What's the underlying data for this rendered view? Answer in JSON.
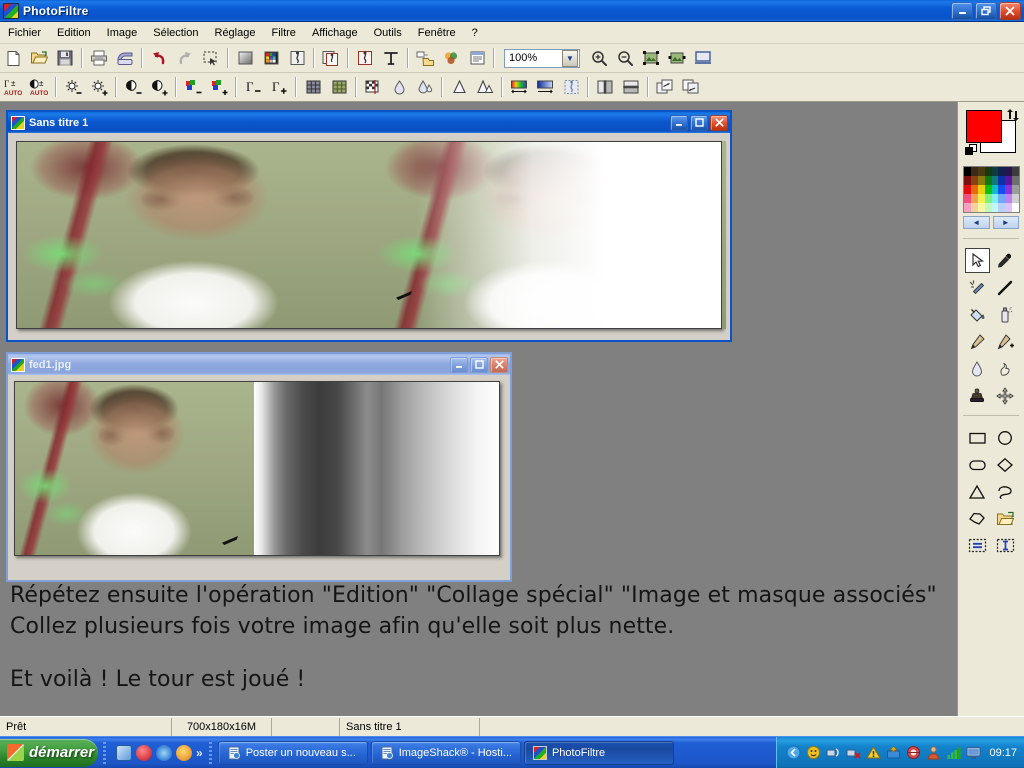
{
  "app": {
    "title": "PhotoFiltre",
    "icon": "photofiltre-icon"
  },
  "window_controls": {
    "minimize": "_",
    "restore": "❐",
    "close": "✕"
  },
  "menu": {
    "items": [
      {
        "label": "Fichier"
      },
      {
        "label": "Edition"
      },
      {
        "label": "Image"
      },
      {
        "label": "Sélection"
      },
      {
        "label": "Réglage"
      },
      {
        "label": "Filtre"
      },
      {
        "label": "Affichage"
      },
      {
        "label": "Outils"
      },
      {
        "label": "Fenêtre"
      },
      {
        "label": "?"
      }
    ]
  },
  "toolbar1": {
    "zoom_value": "100%",
    "buttons": [
      {
        "name": "new-file-icon",
        "title": "Nouveau"
      },
      {
        "name": "open-file-icon",
        "title": "Ouvrir"
      },
      {
        "name": "save-file-icon",
        "title": "Enregistrer"
      },
      {
        "name": "print-icon",
        "title": "Imprimer"
      },
      {
        "name": "scan-icon",
        "title": "Acquisition"
      },
      {
        "name": "undo-icon",
        "title": "Annuler"
      },
      {
        "name": "redo-icon",
        "title": "Rétablir"
      },
      {
        "name": "selection-icon",
        "title": "Sélection"
      },
      {
        "name": "grayscale-icon",
        "title": "Niveaux de gris"
      },
      {
        "name": "palette-icon",
        "title": "Couleurs indexées"
      },
      {
        "name": "mask-icon",
        "title": "Masque"
      },
      {
        "name": "mask-copy-icon",
        "title": "Copier masque"
      },
      {
        "name": "transparency-icon",
        "title": "Transparence"
      },
      {
        "name": "text-icon",
        "title": "Texte"
      },
      {
        "name": "explorer-icon",
        "title": "Explorateur"
      },
      {
        "name": "effects-icon",
        "title": "Effets"
      },
      {
        "name": "module-icon",
        "title": "Modules"
      },
      {
        "name": "zoom-in-icon",
        "title": "Zoom avant"
      },
      {
        "name": "zoom-out-icon",
        "title": "Zoom arrière"
      },
      {
        "name": "fit-width-icon",
        "title": "Ajuster largeur"
      },
      {
        "name": "fit-screen-icon",
        "title": "Taille réelle"
      },
      {
        "name": "fullscreen-icon",
        "title": "Plein écran"
      }
    ]
  },
  "toolbar2": {
    "buttons": [
      {
        "name": "auto-level-icon",
        "title": "Niveaux automatiques"
      },
      {
        "name": "auto-contrast-icon",
        "title": "Contraste automatique"
      },
      {
        "name": "brightness-down-icon",
        "title": "Moins de luminosité"
      },
      {
        "name": "brightness-up-icon",
        "title": "Plus de luminosité"
      },
      {
        "name": "contrast-down-icon",
        "title": "Moins de contraste"
      },
      {
        "name": "contrast-up-icon",
        "title": "Plus de contraste"
      },
      {
        "name": "saturation-down-icon",
        "title": "Moins de saturation"
      },
      {
        "name": "saturation-up-icon",
        "title": "Plus de saturation"
      },
      {
        "name": "gamma-down-icon",
        "title": "Correction gamma -"
      },
      {
        "name": "gamma-up-icon",
        "title": "Correction gamma +"
      },
      {
        "name": "dither-icon",
        "title": "Tramage"
      },
      {
        "name": "mosaic-icon",
        "title": "Mosaïque"
      },
      {
        "name": "checker-icon",
        "title": "Damier"
      },
      {
        "name": "blur-icon",
        "title": "Flou"
      },
      {
        "name": "blur-more-icon",
        "title": "Flou plus"
      },
      {
        "name": "sharpen-icon",
        "title": "Netteté"
      },
      {
        "name": "sharpen-more-icon",
        "title": "Netteté plus"
      },
      {
        "name": "gradient-icon",
        "title": "Dégradé"
      },
      {
        "name": "gradient-blue-icon",
        "title": "Dégradé bleu"
      },
      {
        "name": "texture-icon",
        "title": "Texture"
      },
      {
        "name": "flip-h-icon",
        "title": "Miroir horizontal"
      },
      {
        "name": "flip-v-icon",
        "title": "Miroir vertical"
      },
      {
        "name": "rotate-left-icon",
        "title": "Rotation gauche"
      },
      {
        "name": "rotate-right-icon",
        "title": "Rotation droite"
      }
    ]
  },
  "documents": [
    {
      "title": "Sans titre 1",
      "active": true,
      "image_alt": "tennis-player-duplicated-fade"
    },
    {
      "title": "fed1.jpg",
      "active": false,
      "image_alt": "tennis-player-with-gray-gradient-mask"
    }
  ],
  "instructions": {
    "line1": "Répétez ensuite l'opération \"Edition\" \"Collage spécial\" \"Image et masque associés\"",
    "line2": "Collez plusieurs fois votre image afin qu'elle soit plus nette.",
    "line3": "Et voilà ! Le tour est joué !"
  },
  "palette": {
    "foreground_color": "#ff0000",
    "background_color": "#ffffff",
    "swap_label": "↕",
    "prev_label": "◄",
    "next_label": "►",
    "swatches": [
      "#000000",
      "#3b2a18",
      "#4a3a12",
      "#143a14",
      "#103b3b",
      "#10204f",
      "#2a1450",
      "#3c3c3c",
      "#7a1010",
      "#8a4010",
      "#8a7a10",
      "#107a10",
      "#107a7a",
      "#1030a8",
      "#5a18a0",
      "#6e6e6e",
      "#e01010",
      "#e86a10",
      "#e8d010",
      "#10c010",
      "#10c0c0",
      "#1050f0",
      "#8a30e0",
      "#9c9c9c",
      "#f05080",
      "#f0a050",
      "#f0f050",
      "#80f080",
      "#80f0f0",
      "#70a8f8",
      "#c080f0",
      "#d0d0d0",
      "#f8a0c0",
      "#f8d0a0",
      "#f8f8a0",
      "#c0f8c0",
      "#c0f8f8",
      "#b8d0fa",
      "#e0c0fa",
      "#ffffff"
    ],
    "tools": [
      {
        "name": "arrow-select-tool",
        "label": "Sélection",
        "selected": true
      },
      {
        "name": "eyedropper-tool",
        "label": "Pipette",
        "selected": false
      },
      {
        "name": "magic-wand-tool",
        "label": "Baguette magique",
        "selected": false
      },
      {
        "name": "line-tool",
        "label": "Ligne",
        "selected": false
      },
      {
        "name": "paint-bucket-tool",
        "label": "Remplissage",
        "selected": false
      },
      {
        "name": "spray-tool",
        "label": "Aérographe",
        "selected": false
      },
      {
        "name": "paintbrush-tool",
        "label": "Pinceau",
        "selected": false
      },
      {
        "name": "paintbrush-advanced-tool",
        "label": "Pinceau avancé",
        "selected": false
      },
      {
        "name": "waterdrop-tool",
        "label": "Goutte d'eau",
        "selected": false
      },
      {
        "name": "smudge-tool",
        "label": "Doigt",
        "selected": false
      },
      {
        "name": "stamp-tool",
        "label": "Tampon",
        "selected": false
      },
      {
        "name": "displace-tool",
        "label": "Déplacement",
        "selected": false
      },
      {
        "name": "rectangle-shape-tool",
        "label": "Rectangle",
        "selected": false
      },
      {
        "name": "ellipse-shape-tool",
        "label": "Ellipse",
        "selected": false
      },
      {
        "name": "rounded-rectangle-shape-tool",
        "label": "Rectangle arrondi",
        "selected": false
      },
      {
        "name": "diamond-shape-tool",
        "label": "Losange",
        "selected": false
      },
      {
        "name": "triangle-shape-tool",
        "label": "Triangle",
        "selected": false
      },
      {
        "name": "lasso-shape-tool",
        "label": "Lasso",
        "selected": false
      },
      {
        "name": "polygon-shape-tool",
        "label": "Polygone",
        "selected": false
      },
      {
        "name": "load-shape-tool",
        "label": "Charger une forme",
        "selected": false
      },
      {
        "name": "horizontal-align-tool",
        "label": "Alignement horizontal",
        "selected": false
      },
      {
        "name": "vertical-align-tool",
        "label": "Alignement vertical",
        "selected": false
      }
    ]
  },
  "statusbar": {
    "state": "Prêt",
    "dimensions": "700x180x16M",
    "field3": "",
    "document": "Sans titre 1",
    "field5": ""
  },
  "taskbar": {
    "start_label": "démarrer",
    "quicklaunch": [
      {
        "name": "show-desktop-icon"
      },
      {
        "name": "media-player-icon"
      },
      {
        "name": "internet-explorer-icon"
      },
      {
        "name": "windows-media-icon"
      },
      {
        "name": "more-chevron-icon",
        "label": "»"
      }
    ],
    "tasks": [
      {
        "name": "task-poster",
        "label": "Poster un nouveau s...",
        "active": false
      },
      {
        "name": "task-imageshack",
        "label": "ImageShack® - Hosti...",
        "active": false
      },
      {
        "name": "task-photofiltre",
        "label": "PhotoFiltre",
        "active": true
      }
    ],
    "tray": [
      {
        "name": "tray-expand-icon"
      },
      {
        "name": "tray-messenger-icon"
      },
      {
        "name": "tray-network-icon"
      },
      {
        "name": "tray-network-error-icon"
      },
      {
        "name": "tray-warning-icon"
      },
      {
        "name": "tray-update-icon"
      },
      {
        "name": "tray-antivirus-icon"
      },
      {
        "name": "tray-user-icon"
      },
      {
        "name": "tray-signal-icon"
      },
      {
        "name": "tray-display-icon"
      }
    ],
    "clock": "09:17"
  }
}
